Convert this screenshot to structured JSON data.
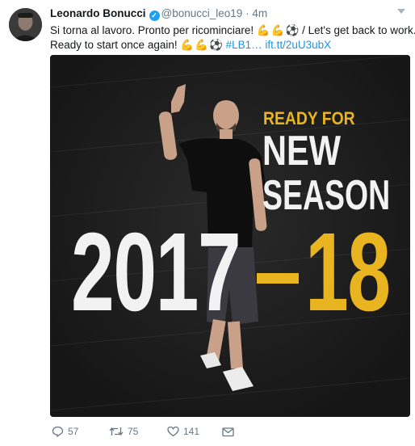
{
  "tweet": {
    "name": "Leonardo Bonucci",
    "handle": "@bonucci_leo19",
    "separator": "·",
    "time": "4m",
    "text_line1_a": "Si torna al lavoro. Pronto per ricominciare!",
    "text_line1_b": "/ Let's get back to work.",
    "text_line2_a": "Ready to start once again!",
    "hashtag": "#LB1…",
    "link": "ift.tt/2uU3ubX"
  },
  "media": {
    "ready_for": "READY FOR",
    "new": "NEW",
    "season": "SEASON",
    "year": "2017",
    "dash": "–",
    "next": "18"
  },
  "actions": {
    "replies": "57",
    "retweets": "75",
    "likes": "141"
  },
  "colors": {
    "accent_gold": "#e8b41f",
    "link_blue": "#1b95e0",
    "verified_blue": "#1da1f2",
    "muted": "#657786"
  },
  "icons": [
    "avatar-photo",
    "verified-badge-icon",
    "caret-down-icon",
    "flexed-biceps-emoji",
    "soccer-ball-emoji",
    "reply-icon",
    "retweet-icon",
    "like-icon",
    "direct-message-icon"
  ]
}
